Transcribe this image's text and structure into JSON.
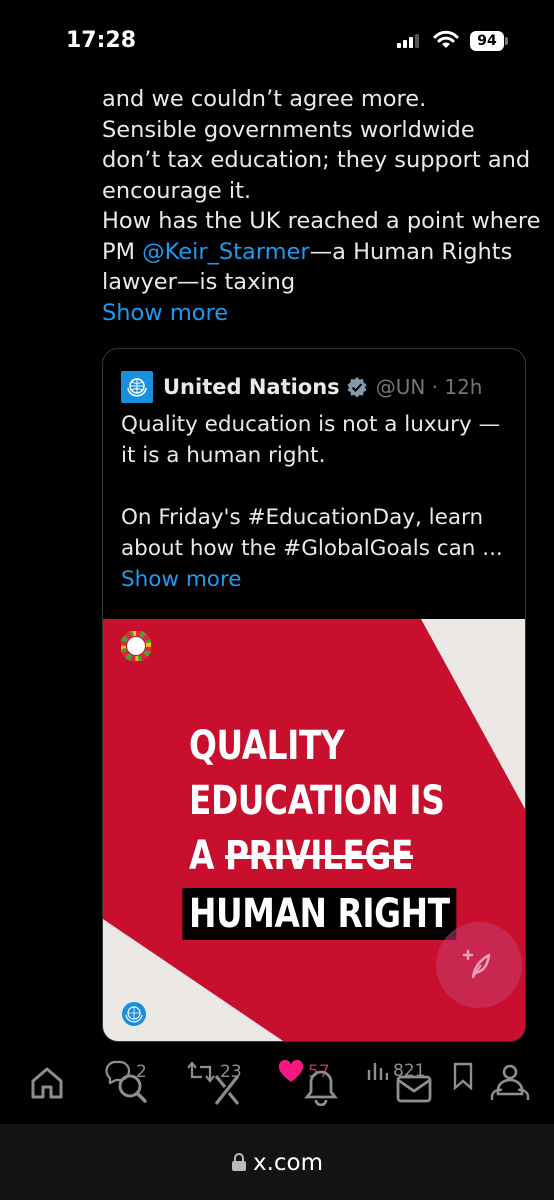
{
  "status_bar": {
    "time": "17:28",
    "battery": "94"
  },
  "tweet": {
    "line1": "and we couldn’t agree more.",
    "line2": "Sensible governments worldwide",
    "line3": "don’t tax education; they support and",
    "line4": "encourage it.",
    "line5": "How has the UK reached a point where",
    "line6_prefix": "PM ",
    "line6_mention": "@Keir_Starmer",
    "line6_suffix": "—a Human Rights",
    "line7": "lawyer—is taxing",
    "show_more": "Show more"
  },
  "quote": {
    "name": "United Nations",
    "handle_time": "@UN · 12h",
    "line1": "Quality education is not a luxury —",
    "line2": "it is a human right.",
    "line3": "On Friday's #EducationDay, learn",
    "line4": "about how the #GlobalGoals can ...",
    "show_more": "Show more",
    "poster": {
      "line1": "QUALITY",
      "line2": "EDUCATION IS",
      "line3_prefix": "A ",
      "line3_struck": "PRIVILEGE",
      "line4": "HUMAN RIGHT"
    }
  },
  "actions": {
    "replies": "2",
    "reposts": "23",
    "likes": "57",
    "views": "821"
  },
  "url_bar": {
    "url": "x.com"
  },
  "colors": {
    "accent": "#1d9bf0",
    "poster_red": "#c8102e",
    "like": "#f91880",
    "un_blue": "#1a8fdd"
  }
}
